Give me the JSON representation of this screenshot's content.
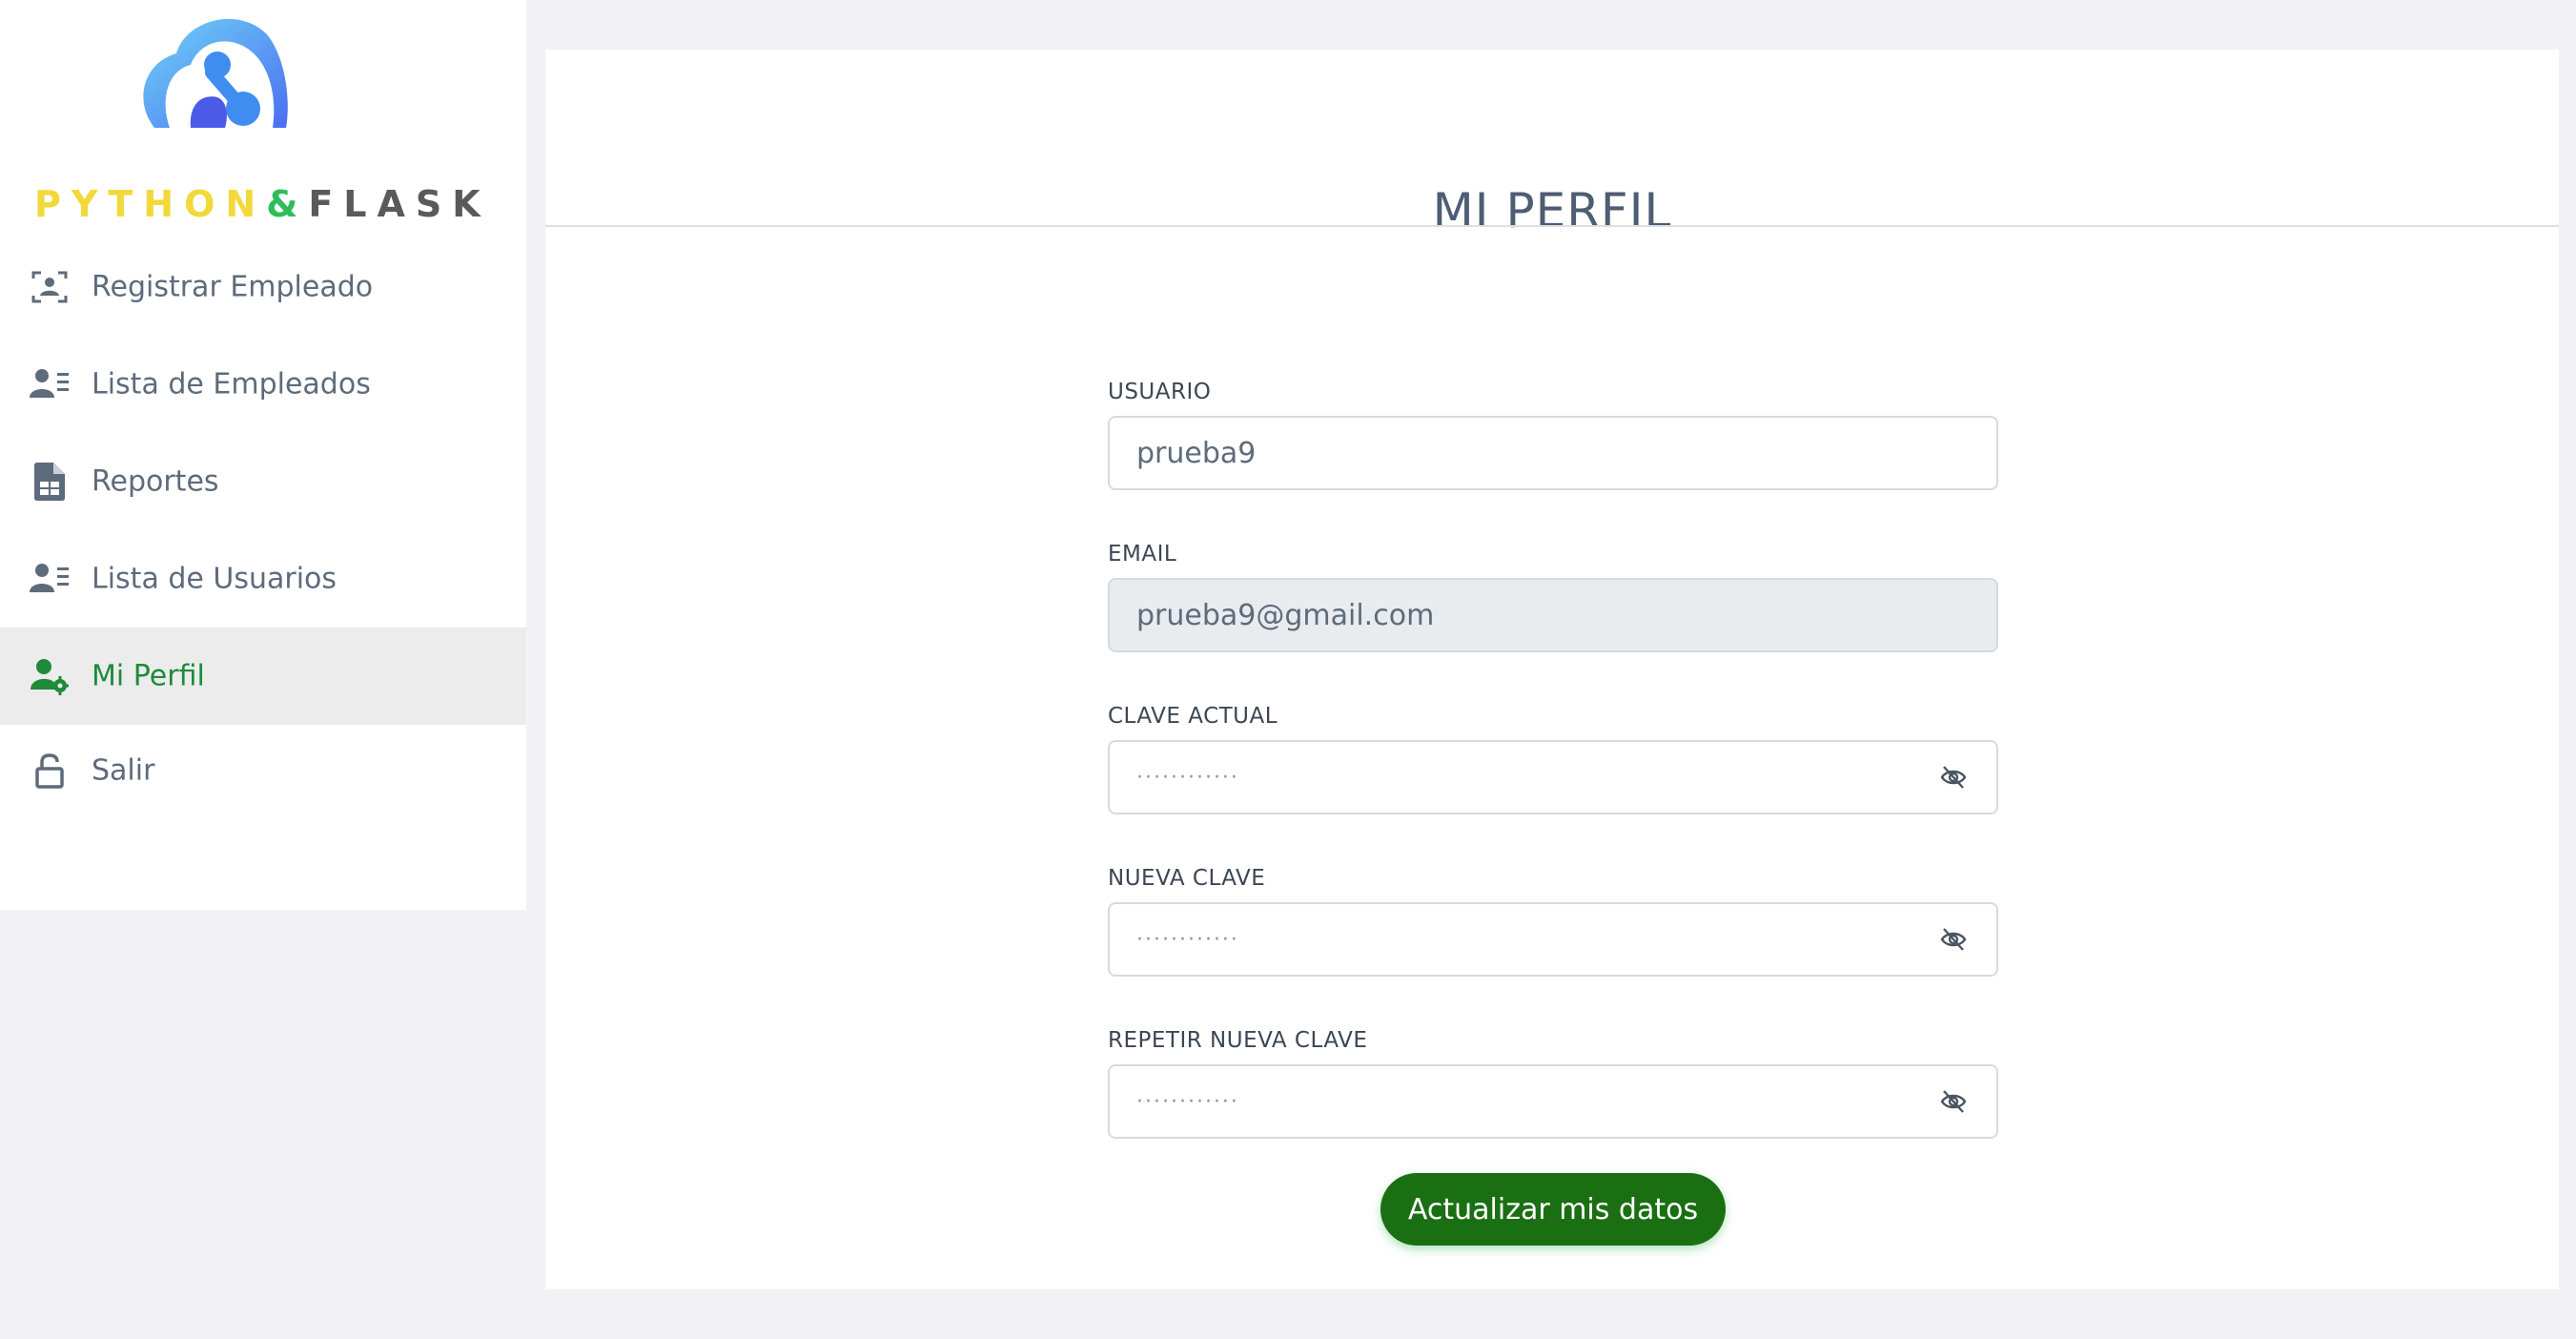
{
  "brand": {
    "python": "PYTHON",
    "amp": "&",
    "flask": "FLASK"
  },
  "sidebar": {
    "items": [
      {
        "label": "Registrar Empleado",
        "icon": "user-scan-icon"
      },
      {
        "label": "Lista de Empleados",
        "icon": "user-list-icon"
      },
      {
        "label": "Reportes",
        "icon": "spreadsheet-file-icon"
      },
      {
        "label": "Lista de Usuarios",
        "icon": "user-list-icon"
      },
      {
        "label": "Mi Perfil",
        "icon": "user-gear-icon",
        "active": true
      },
      {
        "label": "Salir",
        "icon": "unlock-icon"
      }
    ]
  },
  "main": {
    "title": "MI PERFIL",
    "fields": {
      "usuario": {
        "label": "USUARIO",
        "value": "prueba9"
      },
      "email": {
        "label": "EMAIL",
        "value": "prueba9@gmail.com"
      },
      "clave_actual": {
        "label": "CLAVE ACTUAL",
        "value": "············"
      },
      "nueva_clave": {
        "label": "NUEVA CLAVE",
        "value": "············"
      },
      "repetir_clave": {
        "label": "REPETIR NUEVA CLAVE",
        "value": "············"
      }
    },
    "submit_label": "Actualizar mis datos"
  },
  "colors": {
    "active_nav": "#1d8b3a",
    "button_bg": "#1a6f12",
    "nav_text": "#5d6b7c",
    "title_text": "#4d5d72"
  }
}
